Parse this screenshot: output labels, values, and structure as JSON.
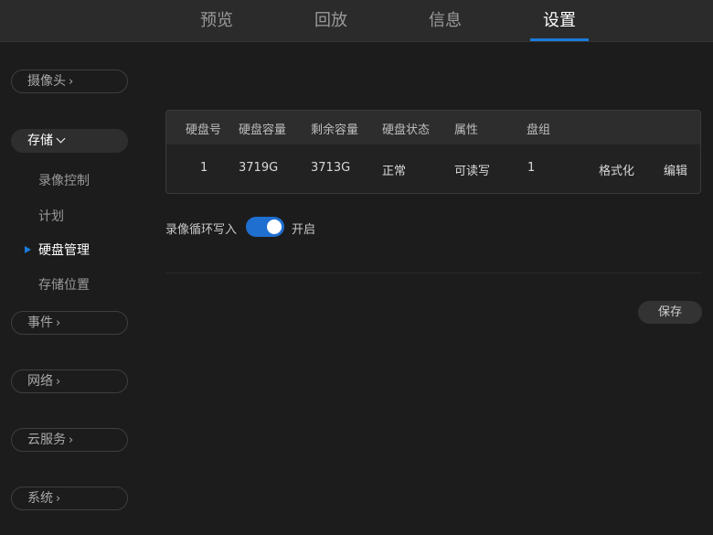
{
  "nav": {
    "tabs": [
      "预览",
      "回放",
      "信息",
      "设置"
    ],
    "active_tab": "设置"
  },
  "sidebar": {
    "camera": "摄像头",
    "storage": "存储",
    "storage_sub": [
      "录像控制",
      "计划",
      "硬盘管理",
      "存储位置"
    ],
    "active_sub": "硬盘管理",
    "event": "事件",
    "network": "网络",
    "cloud": "云服务",
    "system": "系统"
  },
  "disk_table": {
    "headers": [
      "硬盘号",
      "硬盘容量",
      "剩余容量",
      "硬盘状态",
      "属性",
      "盘组"
    ],
    "rows": [
      {
        "id": "1",
        "capacity": "3719G",
        "free": "3713G",
        "status": "正常",
        "attr": "可读写",
        "group": "1",
        "format": "格式化",
        "edit": "编辑"
      }
    ]
  },
  "loop_write": {
    "label": "录像循环写入",
    "enabled": true,
    "state_text": "开启"
  },
  "save_label": "保存",
  "colors": {
    "accent": "#1a7bdc",
    "toggle_on": "#1f6fd0",
    "background": "#1c1c1c",
    "topbar": "#2b2b2b"
  },
  "icons": [
    "chevron-right-icon",
    "chevron-down-icon",
    "active-bullet-icon"
  ]
}
